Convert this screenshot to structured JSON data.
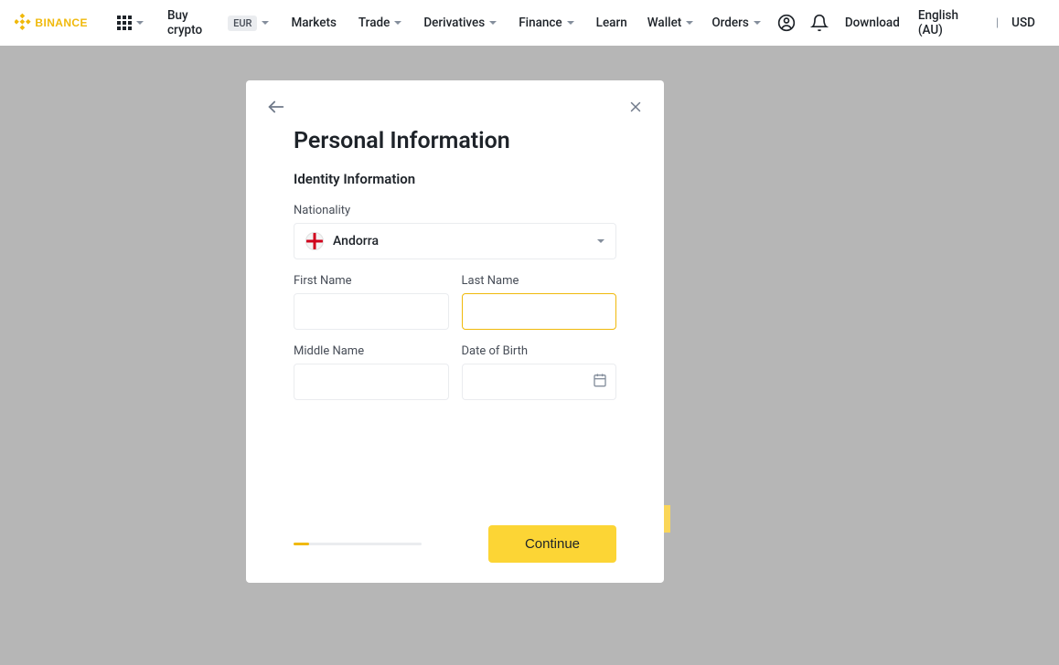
{
  "topnav": {
    "brand": "BINANCE",
    "buy_crypto": "Buy crypto",
    "currency_badge": "EUR",
    "markets": "Markets",
    "trade": "Trade",
    "derivatives": "Derivatives",
    "finance": "Finance",
    "learn": "Learn",
    "wallet": "Wallet",
    "orders": "Orders",
    "download": "Download",
    "language": "English (AU)",
    "fiat": "USD"
  },
  "modal": {
    "title": "Personal Information",
    "section_title": "Identity Information",
    "nationality_label": "Nationality",
    "nationality_value": "Andorra",
    "first_name_label": "First Name",
    "last_name_label": "Last Name",
    "middle_name_label": "Middle Name",
    "dob_label": "Date of Birth",
    "continue": "Continue"
  }
}
